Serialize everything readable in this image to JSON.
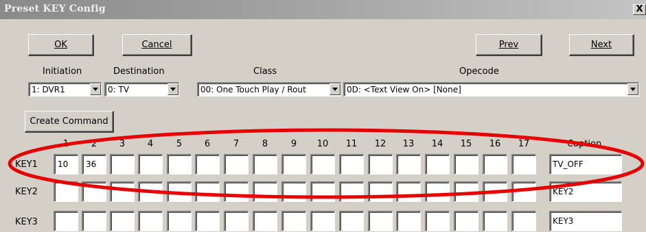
{
  "window": {
    "title": "Preset KEY Config",
    "close_glyph": "X"
  },
  "buttons": {
    "ok": "OK",
    "cancel": "Cancel",
    "prev": "Prev",
    "next": "Next",
    "create_command": "Create Command"
  },
  "selectors": {
    "initiation": {
      "label": "Initiation",
      "value": "1: DVR1"
    },
    "destination": {
      "label": "Destination",
      "value": "0: TV"
    },
    "class": {
      "label": "Class",
      "value": "00: One Touch Play / Rout"
    },
    "opcode": {
      "label": "Opecode",
      "value": "0D: <Text View On> [None]"
    }
  },
  "grid": {
    "columns": [
      "1",
      "2",
      "3",
      "4",
      "5",
      "6",
      "7",
      "8",
      "9",
      "10",
      "11",
      "12",
      "13",
      "14",
      "15",
      "16",
      "17"
    ],
    "caption_header": "Caption",
    "rows": [
      {
        "label": "KEY1",
        "cells": [
          "10",
          "36",
          "",
          "",
          "",
          "",
          "",
          "",
          "",
          "",
          "",
          "",
          "",
          "",
          "",
          "",
          ""
        ],
        "caption": "TV_OFF"
      },
      {
        "label": "KEY2",
        "cells": [
          "",
          "",
          "",
          "",
          "",
          "",
          "",
          "",
          "",
          "",
          "",
          "",
          "",
          "",
          "",
          "",
          ""
        ],
        "caption": "KEY2"
      },
      {
        "label": "KEY3",
        "cells": [
          "",
          "",
          "",
          "",
          "",
          "",
          "",
          "",
          "",
          "",
          "",
          "",
          "",
          "",
          "",
          "",
          ""
        ],
        "caption": "KEY3"
      }
    ]
  },
  "annotation": {
    "ellipse_color": "#e60000"
  }
}
